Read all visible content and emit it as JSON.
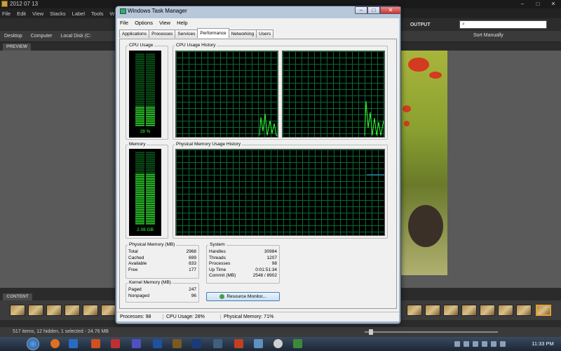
{
  "bg_app": {
    "title": "2012 07 13",
    "menu": [
      "File",
      "Edit",
      "View",
      "Stacks",
      "Label",
      "Tools",
      "W"
    ],
    "path": [
      "Desktop",
      "Computer",
      "Local Disk (C:"
    ],
    "workspace": [
      "TA",
      "OUTPUT"
    ],
    "search_placeholder": "",
    "sort": "Sort Manually",
    "preview_tab": "PREVIEW",
    "content_tab": "CONTENT",
    "status": "517 items, 12 hidden, 1 selected - 24.76 MB"
  },
  "taskbar": {
    "clock": "11:33 PM"
  },
  "tm": {
    "title": "Windows Task Manager",
    "menu": [
      "File",
      "Options",
      "View",
      "Help"
    ],
    "tabs": [
      "Applications",
      "Processes",
      "Services",
      "Performance",
      "Networking",
      "Users"
    ],
    "active_tab": "Performance",
    "cpu_usage_label": "CPU Usage",
    "cpu_usage_value": "28 %",
    "cpu_usage_fraction": 0.28,
    "cpu_history_label": "CPU Usage History",
    "memory_label": "Memory",
    "memory_value": "2.08 GB",
    "memory_fraction": 0.7,
    "mem_history_label": "Physical Memory Usage History",
    "physical_memory": {
      "label": "Physical Memory (MB)",
      "rows": [
        {
          "k": "Total",
          "v": "2968"
        },
        {
          "k": "Cached",
          "v": "699"
        },
        {
          "k": "Available",
          "v": "833"
        },
        {
          "k": "Free",
          "v": "177"
        }
      ]
    },
    "kernel_memory": {
      "label": "Kernel Memory (MB)",
      "rows": [
        {
          "k": "Paged",
          "v": "247"
        },
        {
          "k": "Nonpaged",
          "v": "96"
        }
      ]
    },
    "system": {
      "label": "System",
      "rows": [
        {
          "k": "Handles",
          "v": "30984"
        },
        {
          "k": "Threads",
          "v": "1207"
        },
        {
          "k": "Processes",
          "v": "98"
        },
        {
          "k": "Up Time",
          "v": "0:01:51:34"
        },
        {
          "k": "Commit (MB)",
          "v": "2548 / 8902"
        }
      ]
    },
    "resource_monitor_button": "Resource Monitor...",
    "status": {
      "processes": "Processes: 98",
      "cpu": "CPU Usage: 28%",
      "memory": "Physical Memory: 71%"
    }
  }
}
